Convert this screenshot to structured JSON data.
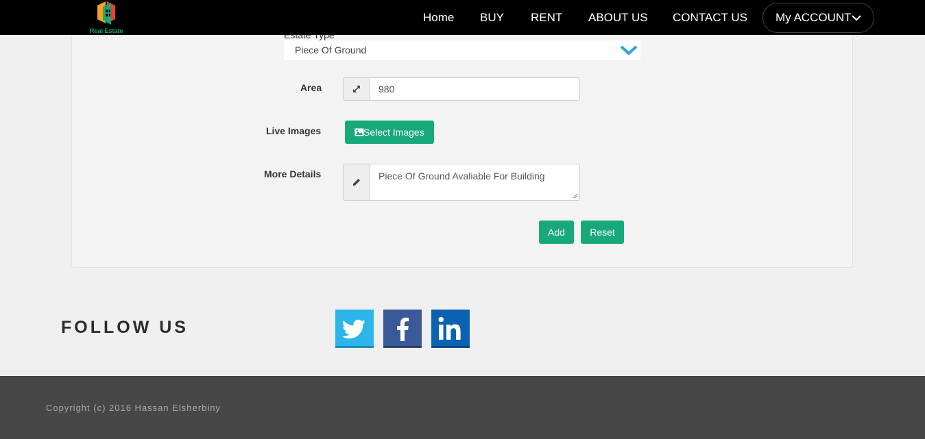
{
  "brand": {
    "logo_text": "Real Estate"
  },
  "nav": {
    "home": "Home",
    "buy": "BUY",
    "rent": "RENT",
    "about": "ABOUT US",
    "contact": "CONTACT US",
    "account": "My ACCOUNT"
  },
  "form": {
    "estate_type_label": "Estate Type",
    "estate_type_value": "Piece Of Ground",
    "area_label": "Area",
    "area_value": "980",
    "images_label": "Live Images",
    "select_images_label": "Select Images",
    "details_label": "More Details",
    "details_value": "Piece Of Ground Avaliable For Building",
    "add_label": "Add",
    "reset_label": "Reset"
  },
  "follow": {
    "title": "FOLLOW US",
    "networks": [
      "twitter",
      "facebook",
      "linkedin"
    ]
  },
  "footer": {
    "copyright": "Copyright (c) 2016 Hassan Elsherbiny"
  },
  "colors": {
    "accent_green": "#18a97a",
    "nav_bg": "#000000",
    "footer_bg": "#474747",
    "twitter": "#2bb5e8",
    "facebook": "#3b5998",
    "linkedin": "#0a63b0"
  }
}
